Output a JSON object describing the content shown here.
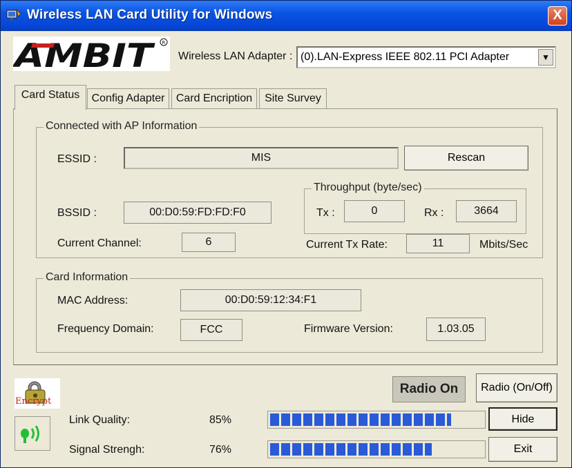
{
  "window": {
    "title": "Wireless LAN Card Utility for Windows",
    "close_label": "X"
  },
  "brand": {
    "logo_text": "AMBIT"
  },
  "adapter": {
    "label": "Wireless LAN Adapter :",
    "selected": "(0).LAN-Express IEEE 802.11 PCI Adapter"
  },
  "tabs": [
    {
      "label": "Card Status"
    },
    {
      "label": "Config Adapter"
    },
    {
      "label": "Card Encription"
    },
    {
      "label": "Site Survey"
    }
  ],
  "ap_info": {
    "title": "Connected with AP Information",
    "essid_label": "ESSID :",
    "essid": "MIS",
    "rescan_label": "Rescan",
    "bssid_label": "BSSID :",
    "bssid": "00:D0:59:FD:FD:F0",
    "channel_label": "Current Channel:",
    "channel": "6",
    "throughput": {
      "title": "Throughput (byte/sec)",
      "tx_label": "Tx :",
      "tx": "0",
      "rx_label": "Rx :",
      "rx": "3664"
    },
    "tx_rate_label": "Current Tx Rate:",
    "tx_rate": "11",
    "tx_rate_unit": "Mbits/Sec"
  },
  "card_info": {
    "title": "Card Information",
    "mac_label": "MAC Address:",
    "mac": "00:D0:59:12:34:F1",
    "domain_label": "Frequency Domain:",
    "domain": "FCC",
    "firmware_label": "Firmware Version:",
    "firmware": "1.03.05"
  },
  "status": {
    "encrypt_label": "Encrypt",
    "radio_state": "Radio On",
    "radio_button": "Radio (On/Off)",
    "hide_button": "Hide",
    "exit_button": "Exit",
    "link_quality_label": "Link Quality:",
    "link_quality": "85%",
    "link_quality_fraction": 0.85,
    "signal_label": "Signal Strengh:",
    "signal": "76%",
    "signal_fraction": 0.76
  },
  "colors": {
    "titlebar": "#0a54e3",
    "bar_fill": "#2a5ad8",
    "signal_icon": "#22c032"
  }
}
